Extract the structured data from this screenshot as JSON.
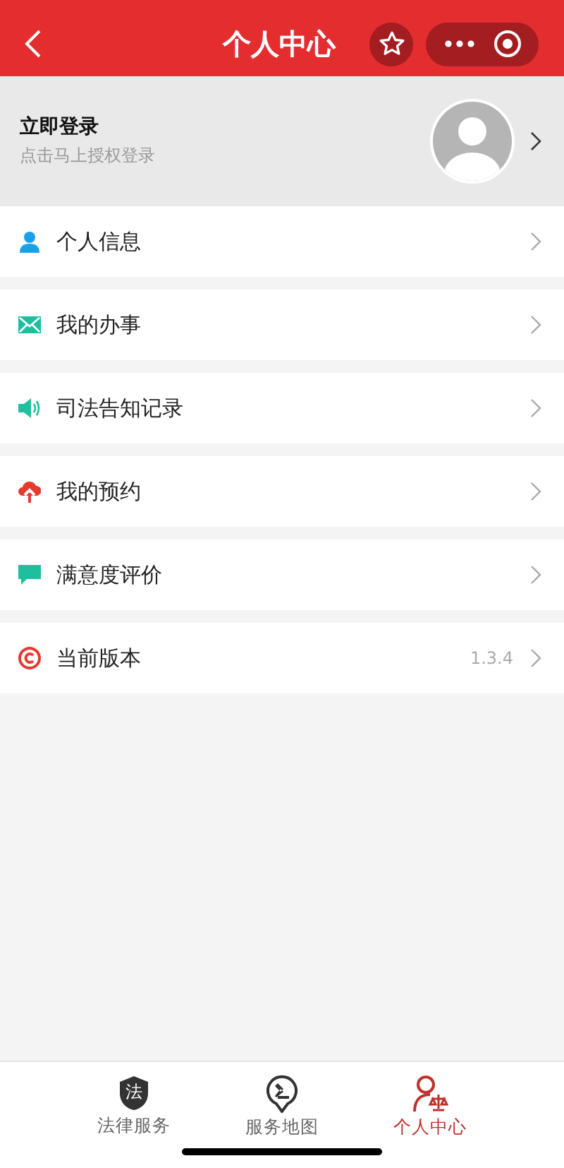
{
  "header": {
    "title": "个人中心"
  },
  "profile": {
    "name": "立即登录",
    "hint": "点击马上授权登录"
  },
  "menu": [
    {
      "label": "个人信息",
      "kind": "person",
      "color": "#1aa0e8"
    },
    {
      "label": "我的办事",
      "kind": "mail",
      "color": "#1dbf9f"
    },
    {
      "label": "司法告知记录",
      "kind": "speaker",
      "color": "#1dbf9f"
    },
    {
      "label": "我的预约",
      "kind": "cloud",
      "color": "#e63a2e"
    },
    {
      "label": "满意度评价",
      "kind": "chat",
      "color": "#1dbf9f"
    },
    {
      "label": "当前版本",
      "kind": "copyright",
      "color": "#e63a2e",
      "value": "1.3.4"
    }
  ],
  "tabs": [
    {
      "label": "法律服务",
      "kind": "shield",
      "icon_text": "法",
      "selected": false
    },
    {
      "label": "服务地图",
      "kind": "pin",
      "selected": false
    },
    {
      "label": "个人中心",
      "kind": "person",
      "selected": true
    }
  ]
}
